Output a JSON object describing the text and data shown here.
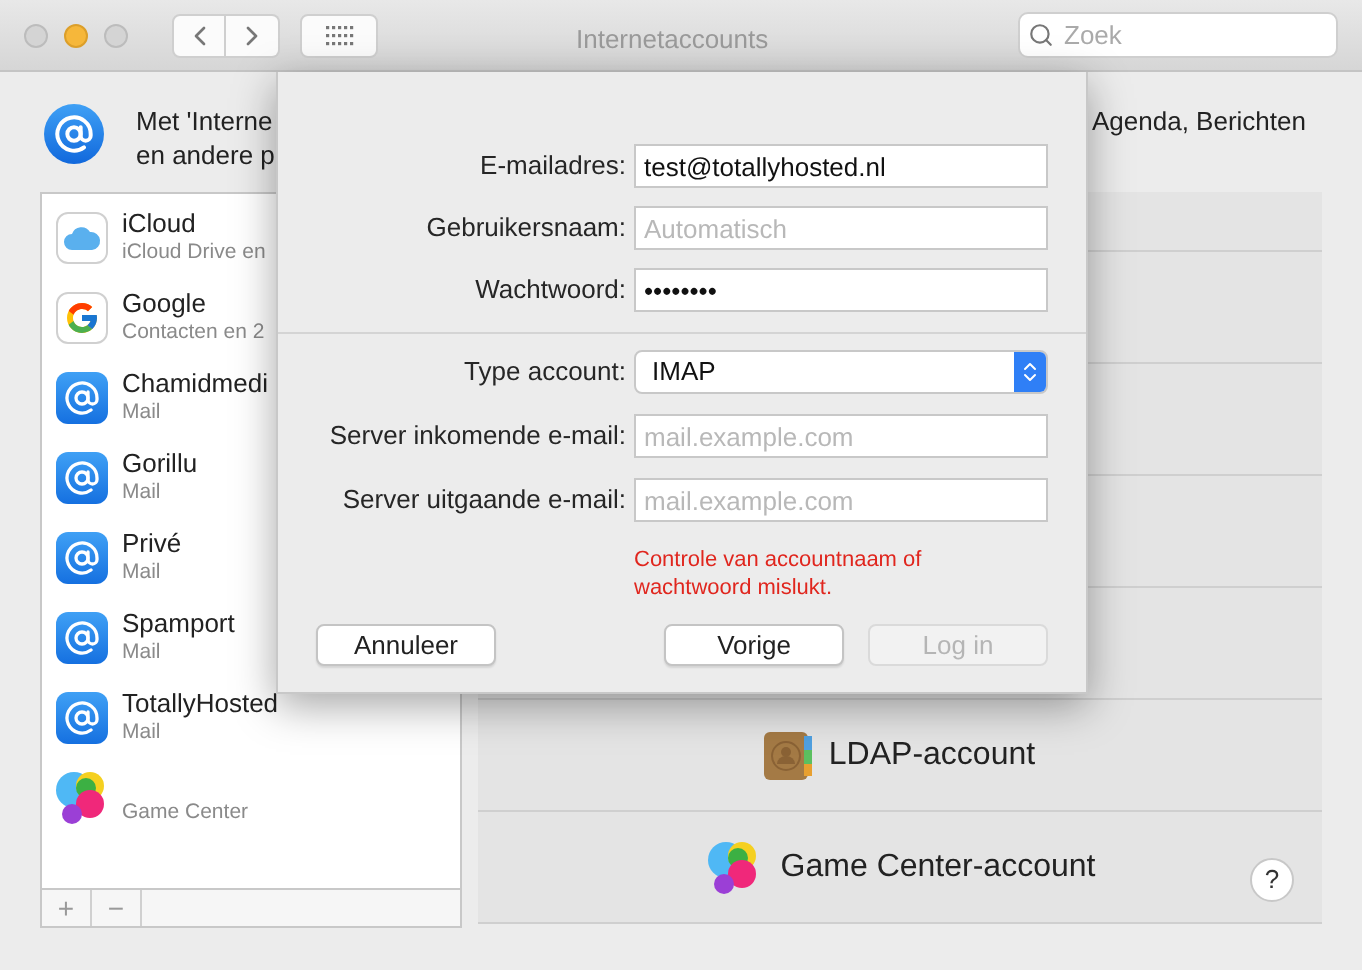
{
  "window": {
    "title": "Internetaccounts",
    "search": {
      "placeholder": "Zoek"
    }
  },
  "header": {
    "text_left": [
      "Met 'Interne",
      "en andere p"
    ],
    "text_right": "Agenda, Berichten"
  },
  "accounts": [
    {
      "name": "iCloud",
      "detail": "iCloud Drive en",
      "kind": "icloud"
    },
    {
      "name": "Google",
      "detail": "Contacten en 2",
      "kind": "google"
    },
    {
      "name": "Chamidmedi",
      "detail": "Mail",
      "kind": "mail"
    },
    {
      "name": "Gorillu",
      "detail": "Mail",
      "kind": "mail"
    },
    {
      "name": "Privé",
      "detail": "Mail",
      "kind": "mail"
    },
    {
      "name": "Spamport",
      "detail": "Mail",
      "kind": "mail"
    },
    {
      "name": "TotallyHosted",
      "detail": "Mail",
      "kind": "mail"
    },
    {
      "detail": "Game Center",
      "kind": "gamecenter"
    }
  ],
  "list_buttons": [
    "+",
    "−"
  ],
  "providers": [
    {
      "label": "LDAP-account",
      "kind": "ldap"
    },
    {
      "label": "Game Center-account",
      "kind": "gamecenter"
    }
  ],
  "help": "?",
  "sheet": {
    "fields": [
      {
        "label": "E-mailadres:",
        "value": "test@totallyhosted.nl"
      },
      {
        "label": "Gebruikersnaam:",
        "placeholder": "Automatisch"
      },
      {
        "label": "Wachtwoord:",
        "value": "••••••••"
      }
    ],
    "account_type": {
      "label": "Type account:",
      "value": "IMAP"
    },
    "server_fields": [
      {
        "label": "Server inkomende e-mail:",
        "placeholder": "mail.example.com"
      },
      {
        "label": "Server uitgaande e-mail:",
        "placeholder": "mail.example.com"
      }
    ],
    "error": "Controle van accountnaam of wachtwoord mislukt.",
    "buttons": [
      {
        "label": "Annuleer",
        "disabled": false
      },
      {
        "label": "Vorige",
        "disabled": false
      },
      {
        "label": "Log in",
        "disabled": true
      }
    ]
  }
}
